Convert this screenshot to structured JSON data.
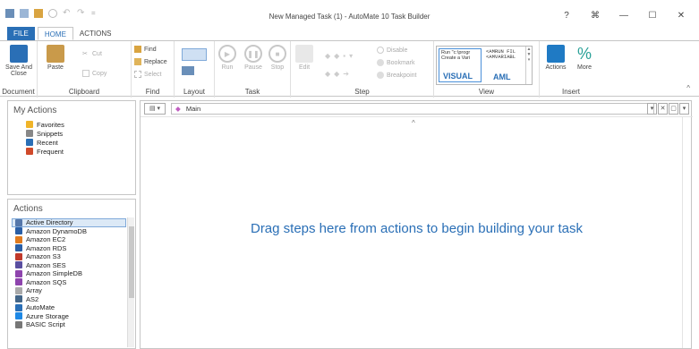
{
  "window": {
    "title": "New Managed Task (1) - AutoMate 10 Task Builder",
    "controls": [
      "?",
      "⌘",
      "—",
      "☐",
      "✕"
    ]
  },
  "tabs": [
    "FILE",
    "HOME",
    "ACTIONS"
  ],
  "ribbon": {
    "document": {
      "label": "Document",
      "save_close": "Save And Close"
    },
    "clipboard": {
      "label": "Clipboard",
      "paste": "Paste",
      "cut": "Cut",
      "copy": "Copy"
    },
    "find": {
      "label": "Find",
      "find": "Find",
      "replace": "Replace",
      "select": "Select"
    },
    "layout": {
      "label": "Layout"
    },
    "task": {
      "label": "Task",
      "run": "Run",
      "pause": "Pause",
      "stop": "Stop"
    },
    "step": {
      "label": "Step",
      "edit": "Edit",
      "disable": "Disable",
      "bookmark": "Bookmark",
      "breakpoint": "Breakpoint"
    },
    "view": {
      "label": "View",
      "visual_text": "Run \"c:\\progr Create a Vari",
      "visual": "VISUAL",
      "aml_text": "<AMRUN FIL <AMVARIABL",
      "aml": "AML"
    },
    "insert": {
      "label": "Insert",
      "actions": "Actions",
      "more": "More"
    }
  },
  "my_actions": {
    "title": "My Actions",
    "items": [
      {
        "label": "Favorites",
        "color": "#f0b429"
      },
      {
        "label": "Snippets",
        "color": "#888888"
      },
      {
        "label": "Recent",
        "color": "#2a6fb6"
      },
      {
        "label": "Frequent",
        "color": "#d04a2a"
      }
    ]
  },
  "actions": {
    "title": "Actions",
    "items": [
      {
        "label": "Active Directory",
        "color": "#5577aa"
      },
      {
        "label": "Amazon DynamoDB",
        "color": "#2a5fa6"
      },
      {
        "label": "Amazon EC2",
        "color": "#e07b1f"
      },
      {
        "label": "Amazon RDS",
        "color": "#2a5fa6"
      },
      {
        "label": "Amazon S3",
        "color": "#c0392b"
      },
      {
        "label": "Amazon SES",
        "color": "#5a4ea0"
      },
      {
        "label": "Amazon SimpleDB",
        "color": "#8e44ad"
      },
      {
        "label": "Amazon SQS",
        "color": "#8e44ad"
      },
      {
        "label": "Array",
        "color": "#aaaaaa"
      },
      {
        "label": "AS2",
        "color": "#446688"
      },
      {
        "label": "AutoMate",
        "color": "#2a6fb6"
      },
      {
        "label": "Azure Storage",
        "color": "#1e88e5"
      },
      {
        "label": "BASIC Script",
        "color": "#777777"
      }
    ]
  },
  "main": {
    "doc_tab": "Main",
    "hint": "Drag steps here from actions to begin building your task"
  }
}
